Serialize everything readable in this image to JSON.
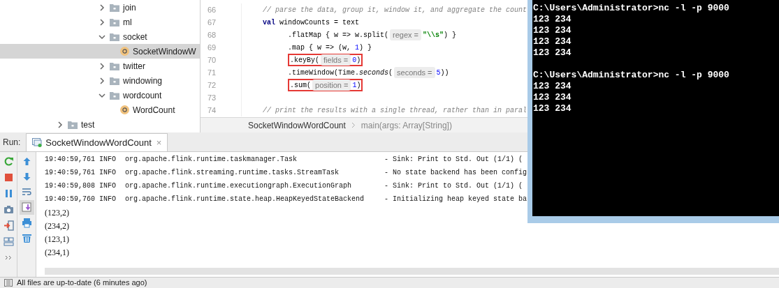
{
  "project_tree": {
    "items": [
      {
        "kind": "group",
        "children": [
          {
            "kind": "folder",
            "label": "join",
            "expanded": false,
            "selected": false
          },
          {
            "kind": "folder",
            "label": "ml",
            "expanded": false,
            "selected": false
          },
          {
            "kind": "folder",
            "label": "socket",
            "expanded": true,
            "selected": false,
            "children": [
              {
                "kind": "class",
                "label": "SocketWindowW",
                "selected": true
              }
            ]
          },
          {
            "kind": "folder",
            "label": "twitter",
            "expanded": false,
            "selected": false
          },
          {
            "kind": "folder",
            "label": "windowing",
            "expanded": false,
            "selected": false
          },
          {
            "kind": "folder",
            "label": "wordcount",
            "expanded": true,
            "selected": false,
            "children": [
              {
                "kind": "class",
                "label": "WordCount",
                "selected": false
              }
            ]
          }
        ]
      },
      {
        "kind": "folder",
        "label": "test",
        "expanded": false,
        "selected": false
      }
    ]
  },
  "editor": {
    "lines": [
      {
        "number": "66",
        "highlighted": false,
        "segments": [
          {
            "kind": "comment",
            "text": "// parse the data, group it, window it, and aggregate the count"
          }
        ]
      },
      {
        "number": "67",
        "highlighted": false,
        "segments": [
          {
            "kind": "keyword",
            "text": "val"
          },
          {
            "kind": "plain",
            "text": " windowCounts = text"
          }
        ]
      },
      {
        "number": "68",
        "kind": "chained",
        "highlighted": false,
        "segments": [
          {
            "kind": "plain",
            "text": ".flatMap { w => w.split("
          },
          {
            "kind": "hint",
            "text": "regex ="
          },
          {
            "kind": "string",
            "text": "\"\\\\s\""
          },
          {
            "kind": "plain",
            "text": ") }"
          }
        ]
      },
      {
        "number": "69",
        "kind": "chained",
        "highlighted": false,
        "segments": [
          {
            "kind": "plain",
            "text": ".map { w => (w, "
          },
          {
            "kind": "number",
            "text": "1"
          },
          {
            "kind": "plain",
            "text": ") }"
          }
        ]
      },
      {
        "number": "70",
        "kind": "chained",
        "highlighted": true,
        "segments": [
          {
            "kind": "plain",
            "text": ".keyBy("
          },
          {
            "kind": "hint",
            "text": "fields ="
          },
          {
            "kind": "number",
            "text": "0"
          },
          {
            "kind": "plain",
            "text": ")"
          }
        ]
      },
      {
        "number": "71",
        "kind": "chained",
        "highlighted": false,
        "segments": [
          {
            "kind": "plain",
            "text": ".timeWindow(Time."
          },
          {
            "kind": "italic",
            "text": "seconds"
          },
          {
            "kind": "plain",
            "text": "("
          },
          {
            "kind": "hint",
            "text": "seconds ="
          },
          {
            "kind": "number",
            "text": "5"
          },
          {
            "kind": "plain",
            "text": "))"
          }
        ]
      },
      {
        "number": "72",
        "kind": "chained",
        "highlighted": true,
        "segments": [
          {
            "kind": "plain",
            "text": ".sum("
          },
          {
            "kind": "hint",
            "text": "position ="
          },
          {
            "kind": "number",
            "text": "1"
          },
          {
            "kind": "plain",
            "text": ")"
          }
        ]
      },
      {
        "number": "73",
        "highlighted": false
      },
      {
        "number": "74",
        "highlighted": false,
        "segments": [
          {
            "kind": "comment",
            "text": "// print the results with a single thread, rather than in paral"
          }
        ]
      }
    ],
    "breadcrumb": [
      "SocketWindowWordCount",
      "main(args: Array[String])"
    ]
  },
  "run_panel": {
    "label": "Run:",
    "tabs": [
      {
        "label": "SocketWindowWordCount",
        "selected": true,
        "close": "×"
      }
    ],
    "console": [
      {
        "kind": "log",
        "time": "19:40:59,761 INFO",
        "source": "org.apache.flink.runtime.taskmanager.Task",
        "message": "- Sink: Print to Std. Out (1/1) ("
      },
      {
        "kind": "log",
        "time": "19:40:59,761 INFO",
        "source": "org.apache.flink.streaming.runtime.tasks.StreamTask",
        "message": "- No state backend has been config"
      },
      {
        "kind": "log",
        "time": "19:40:59,808 INFO",
        "source": "org.apache.flink.runtime.executiongraph.ExecutionGraph",
        "message": "- Sink: Print to Std. Out (1/1) ("
      },
      {
        "kind": "log",
        "time": "19:40:59,760 INFO",
        "source": "org.apache.flink.runtime.state.heap.HeapKeyedStateBackend",
        "message": "- Initializing heap keyed state ba"
      },
      {
        "kind": "output",
        "text": "(123,2)"
      },
      {
        "kind": "output",
        "text": "(234,2)"
      },
      {
        "kind": "output",
        "text": "(123,1)"
      },
      {
        "kind": "output",
        "text": "(234,1)"
      }
    ]
  },
  "status_bar": {
    "text": "All files are up-to-date (6 minutes ago)"
  },
  "terminal": {
    "sessions": [
      {
        "command": "C:\\Users\\Administrator>nc -l -p 9000",
        "output": [
          "123 234",
          "123 234",
          "123 234",
          "123 234"
        ]
      },
      {
        "command": "C:\\Users\\Administrator>nc -l -p 9000",
        "output": [
          "123 234",
          "123 234",
          "123 234"
        ]
      }
    ]
  }
}
